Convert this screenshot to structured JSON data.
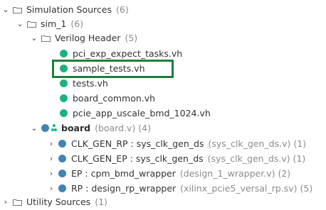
{
  "tree": {
    "simulation_sources": {
      "label": "Simulation Sources",
      "meta": "(6)"
    },
    "sim_1": {
      "label": "sim_1",
      "meta": "(6)"
    },
    "verilog_header": {
      "label": "Verilog Header",
      "meta": "(5)"
    },
    "headers": [
      "pci_exp_expect_tasks.vh",
      "sample_tests.vh",
      "tests.vh",
      "board_common.vh",
      "pcie_app_uscale_bmd_1024.vh"
    ],
    "board": {
      "label": "board",
      "meta": "(board.v) (4)"
    },
    "children": [
      {
        "label": "CLK_GEN_RP : sys_clk_gen_ds",
        "meta": "(sys_clk_gen_ds.v) (1)"
      },
      {
        "label": "CLK_GEN_EP : sys_clk_gen_ds",
        "meta": "(sys_clk_gen_ds.v) (1)"
      },
      {
        "label": "EP : cpm_bmd_wrapper",
        "meta": "(design_1_wrapper.v) (2)"
      },
      {
        "label": "RP : design_rp_wrapper",
        "meta": "(xilinx_pcie5_versal_rp.sv) (5)"
      }
    ],
    "utility_sources": {
      "label": "Utility Sources",
      "meta": "(1)"
    }
  },
  "colors": {
    "selection_box": "#1f7d3a",
    "file_dot": "#1bb37a",
    "module_dot": "#3f84b7"
  }
}
